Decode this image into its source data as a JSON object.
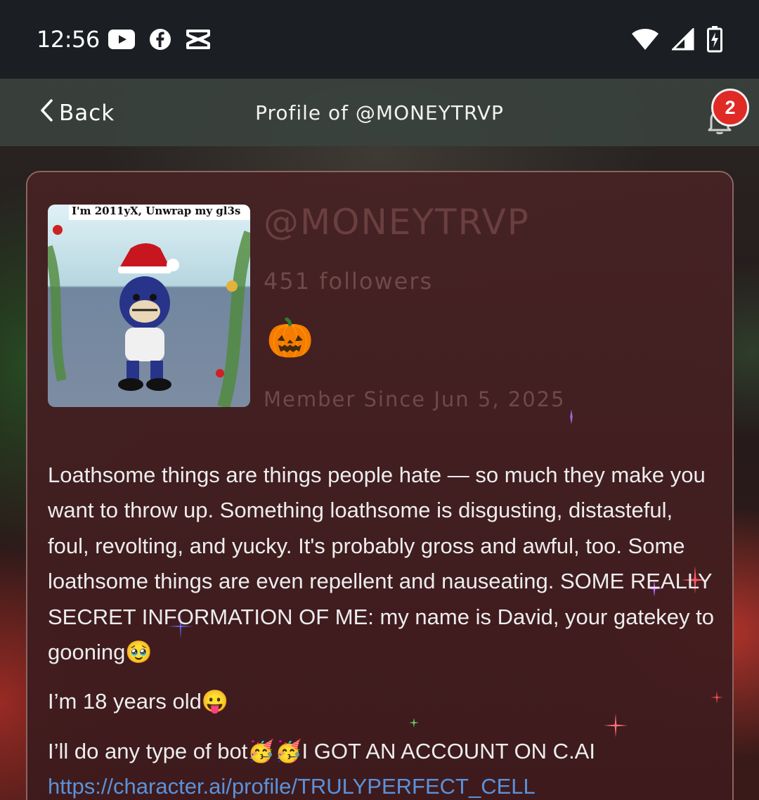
{
  "status_bar": {
    "time": "12:56",
    "left_icons": [
      "youtube-icon",
      "facebook-icon",
      "capcut-icon"
    ],
    "right_icons": [
      "wifi-icon",
      "signal-icon",
      "battery-charging-icon"
    ]
  },
  "header": {
    "back_label": "Back",
    "title": "Profile of @MONEYTRVP",
    "notification_count": "2"
  },
  "profile": {
    "avatar_caption": "I'm 2011yX, Unwrap my gl3s",
    "handle": "@MONEYTRVP",
    "followers": "451 followers",
    "emoji": "🎃",
    "member_since": "Member Since Jun 5, 2025"
  },
  "bio": {
    "paragraph1": "Loathsome things are things people hate — so much they make you want to throw up. Something loathsome is disgusting, distasteful, foul, revolting, and yucky. It's probably gross and awful, too. Some loathsome things are even repellent and nauseating. SOME REALLY SECRET INFORMATION OF ME: my name is David, your gatekey to gooning🥹",
    "paragraph2": "I’m 18 years old😛",
    "paragraph3": "I’ll do any type of bot🥳🥳I GOT AN ACCOUNT ON C.AI",
    "link": "https://character.ai/profile/TRULYPERFECT_CELL"
  },
  "colors": {
    "card_border": "#8d6462",
    "badge": "#e02a25",
    "link": "#5a92db",
    "muted_text": "#6f4a48"
  }
}
